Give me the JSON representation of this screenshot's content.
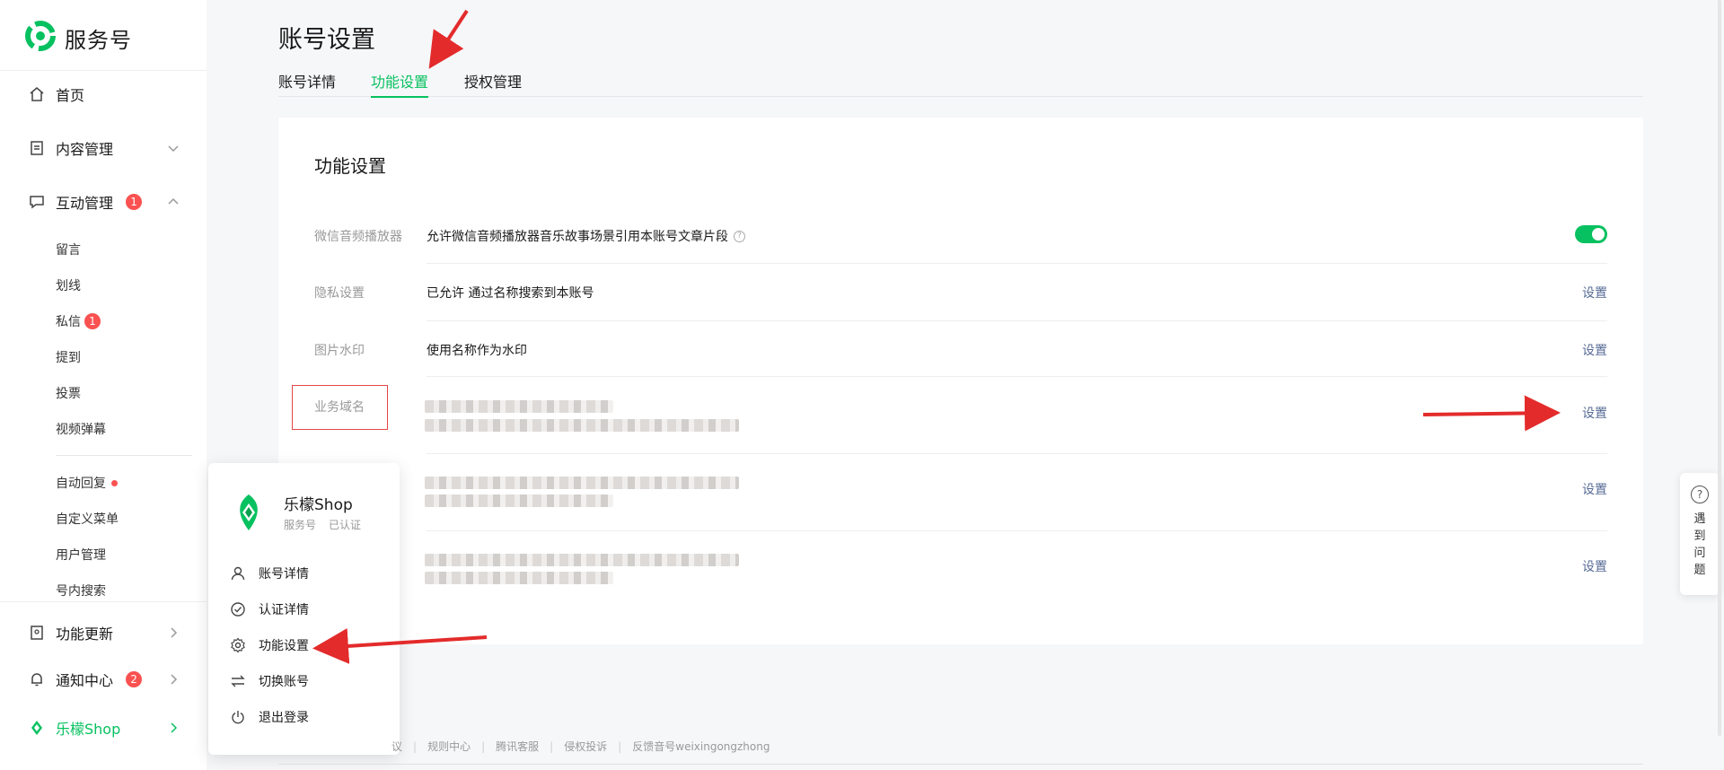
{
  "sidebar": {
    "brand": "服务号",
    "home": "首页",
    "content": "内容管理",
    "interaction": {
      "label": "互动管理",
      "badge": "1"
    },
    "sub_items": {
      "message": "留言",
      "underline": "划线",
      "private_msg": {
        "label": "私信",
        "badge": "1"
      },
      "mention": "提到",
      "vote": "投票",
      "video_danmaku": "视频弹幕",
      "auto_reply": "自动回复",
      "custom_menu": "自定义菜单",
      "user_mgmt": "用户管理",
      "in_account_search": "号内搜索"
    },
    "feature_update": "功能更新",
    "notification": {
      "label": "通知中心",
      "badge": "2"
    },
    "account": "乐檬Shop"
  },
  "header": {
    "title": "账号设置",
    "tabs": [
      "账号详情",
      "功能设置",
      "授权管理"
    ],
    "active_tab": "功能设置"
  },
  "card": {
    "title": "功能设置",
    "rows": [
      {
        "label": "微信音频播放器",
        "desc": "允许微信音频播放器音乐故事场景引用本账号文章片段",
        "toggle_on": true
      },
      {
        "label": "隐私设置",
        "desc": "已允许 通过名称搜索到本账号",
        "action": "设置"
      },
      {
        "label": "图片水印",
        "desc": "使用名称作为水印",
        "action": "设置"
      },
      {
        "label": "业务域名",
        "action": "设置"
      },
      {
        "action": "设置"
      },
      {
        "action": "设置"
      }
    ]
  },
  "popup": {
    "name": "乐檬Shop",
    "type": "服务号",
    "status": "已认证",
    "items": [
      "账号详情",
      "认证详情",
      "功能设置",
      "切换账号",
      "退出登录"
    ]
  },
  "float_help": {
    "label": "遇到问题"
  },
  "footer": {
    "links": [
      "议",
      "规则中心",
      "腾讯客服",
      "侵权投诉",
      "反馈音号weixingongzhong"
    ]
  },
  "colors": {
    "accent": "#07c160",
    "link": "#576b95",
    "badge": "#fa5151",
    "annotation": "#e32b2b"
  }
}
